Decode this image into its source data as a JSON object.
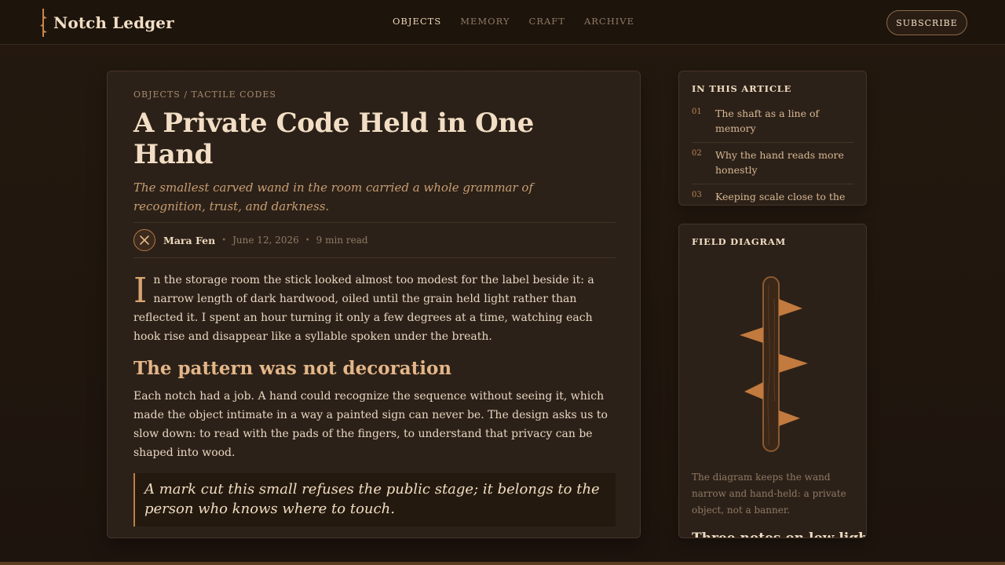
{
  "brand": {
    "name": "Notch Ledger"
  },
  "nav": {
    "items": [
      {
        "label": "OBJECTS",
        "active": true
      },
      {
        "label": "MEMORY",
        "active": false
      },
      {
        "label": "CRAFT",
        "active": false
      },
      {
        "label": "ARCHIVE",
        "active": false
      }
    ],
    "subscribe_label": "SUBSCRIBE"
  },
  "article": {
    "breadcrumb": "OBJECTS / TACTILE CODES",
    "title": "A Private Code Held in One Hand",
    "dek": "The smallest carved wand in the room carried a whole grammar of recognition, trust, and darkness.",
    "author": "Mara Fen",
    "date": "June 12, 2026",
    "read_time": "9 min read",
    "dropcap": "I",
    "lead": "n the storage room the stick looked almost too modest for the label beside it: a narrow length of dark hardwood, oiled until the grain held light rather than reflected it. I spent an hour turning it only a few degrees at a time, watching each hook rise and disappear like a syllable spoken under the breath.",
    "section_heading": "The pattern was not decoration",
    "paragraph": "Each notch had a job. A hand could recognize the sequence without seeing it, which made the object intimate in a way a painted sign can never be. The design asks us to slow down: to read with the pads of the fingers, to understand that privacy can be shaped into wood.",
    "pullquote": "A mark cut this small refuses the public stage; it belongs to the person who knows where to touch."
  },
  "toc": {
    "heading": "IN THIS ARTICLE",
    "items": [
      {
        "num": "01",
        "label": "The shaft as a line of memory"
      },
      {
        "num": "02",
        "label": "Why the hand reads more honestly"
      },
      {
        "num": "03",
        "label": "Keeping scale close to the body"
      }
    ]
  },
  "diagram": {
    "heading": "FIELD DIAGRAM",
    "caption": "The diagram keeps the wand narrow and hand-held: a private object, not a banner.",
    "next_heading": "Three notes on low light"
  },
  "colors": {
    "accent": "#c07e45",
    "background": "#22170f",
    "card": "#2c2118",
    "heading": "#e3b689"
  },
  "icons": {
    "avatar": "crossed-sticks-icon",
    "brand": "notched-stick-icon"
  }
}
